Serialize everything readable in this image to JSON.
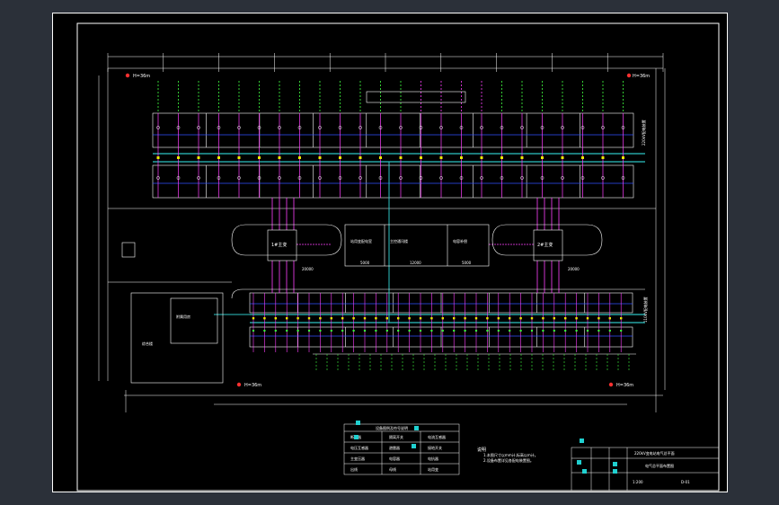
{
  "colors": {
    "background": "#2b3039",
    "sheet": "#000000",
    "lines": "#ffffff",
    "bus": "#2ec4c4",
    "feeder": "#ff40ff",
    "branch": "#3050ff",
    "outgoing": "#40ff40",
    "dims": "#e8e800",
    "markers": "#ff3030",
    "grips": "#20d0d0"
  },
  "labels": {
    "elev_tl": "H=36m",
    "elev_tr": "H=36m",
    "elev_bl": "H=36m",
    "elev_br": "H=36m",
    "transformer1": "1#主变",
    "transformer2": "2#主变",
    "control_room": "主控通讯楼",
    "station_service": "站用变配电室",
    "capacitor": "电容补偿",
    "hv_side_label": "220kV配电装置",
    "lv_side_label": "110kV配电装置",
    "left_building": "综合楼",
    "left_building_b": "附属用房",
    "dim_20000_l": "20000",
    "dim_20000_r": "20000",
    "dim_mid_a": "5000",
    "dim_mid_b": "12000",
    "dim_mid_c": "5000"
  },
  "legend": {
    "title": "设备图例及符号说明",
    "rows": [
      {
        "a": "断路器",
        "b": "隔离开关",
        "c": "电流互感器"
      },
      {
        "a": "电压互感器",
        "b": "避雷器",
        "c": "接地开关"
      },
      {
        "a": "主变压器",
        "b": "电容器",
        "c": "电抗器"
      },
      {
        "a": "出线",
        "b": "母线",
        "c": "站用变"
      }
    ]
  },
  "notes": {
    "heading": "说明",
    "line1": "1.本图尺寸以mm计,标高以m计。",
    "line2": "2.设备布置详见各配电装置图。"
  },
  "title_block": {
    "project": "220kV变电站电气总平面",
    "drawing": "电气总平面布置图",
    "scale": "1:200",
    "sheet_no": "D-01"
  }
}
